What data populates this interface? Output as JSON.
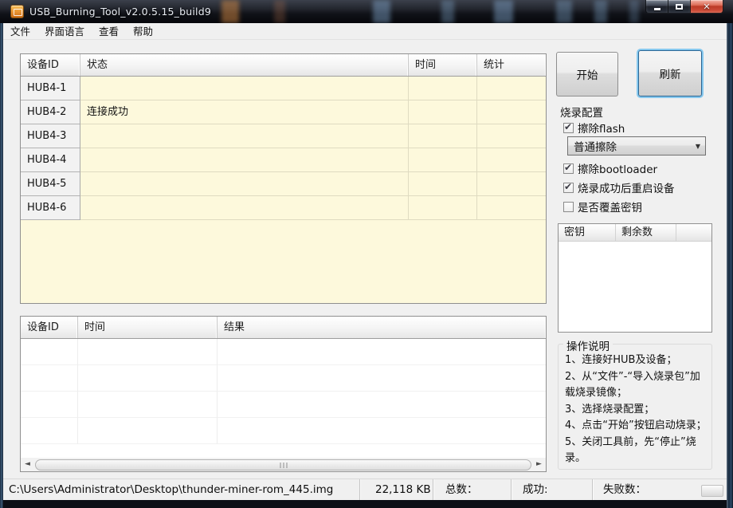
{
  "window": {
    "title": "USB_Burning_Tool_v2.0.5.15_build9",
    "controls": {
      "minimize": "minimize",
      "maximize": "maximize",
      "close": "✕"
    }
  },
  "menu": {
    "items": [
      "文件",
      "界面语言",
      "查看",
      "帮助"
    ]
  },
  "device_table": {
    "headers": [
      "设备ID",
      "状态",
      "时间",
      "统计"
    ],
    "rows": [
      {
        "id": "HUB4-1",
        "status": "",
        "time": "",
        "stat": ""
      },
      {
        "id": "HUB4-2",
        "status": "连接成功",
        "time": "",
        "stat": ""
      },
      {
        "id": "HUB4-3",
        "status": "",
        "time": "",
        "stat": ""
      },
      {
        "id": "HUB4-4",
        "status": "",
        "time": "",
        "stat": ""
      },
      {
        "id": "HUB4-5",
        "status": "",
        "time": "",
        "stat": ""
      },
      {
        "id": "HUB4-6",
        "status": "",
        "time": "",
        "stat": ""
      }
    ]
  },
  "actions": {
    "start": "开始",
    "refresh": "刷新"
  },
  "burn_config": {
    "title": "烧录配置",
    "options": [
      {
        "label": "擦除flash",
        "checked": true
      },
      {
        "label": "擦除bootloader",
        "checked": true
      },
      {
        "label": "烧录成功后重启设备",
        "checked": true
      },
      {
        "label": "是否覆盖密钥",
        "checked": false
      }
    ],
    "erase_mode": "普通擦除"
  },
  "key_table": {
    "headers": [
      "密钥",
      "剩余数"
    ]
  },
  "instructions": {
    "title": "操作说明",
    "lines": [
      "1、连接好HUB及设备；",
      "2、从“文件”-“导入烧录包”加载烧录镜像；",
      "3、选择烧录配置；",
      "4、点击“开始”按钮启动烧录；",
      "5、关闭工具前，先“停止”烧录。"
    ]
  },
  "log_table": {
    "headers": [
      "设备ID",
      "时间",
      "结果"
    ]
  },
  "status_bar": {
    "file_path": "C:\\Users\\Administrator\\Desktop\\thunder-miner-rom_445.img",
    "file_size": "22,118 KB",
    "total_label": "总数：",
    "success_label": "成功:",
    "failure_label": "失败数："
  },
  "icons": {
    "dropdown_arrow": "▼",
    "scroll_left": "◄",
    "scroll_right": "►"
  },
  "colors": {
    "close_red": "#c2412e",
    "focus_blue": "#86c8ee",
    "table_yellow": "#fdf9dc",
    "frame_blue": "#1b3954"
  }
}
